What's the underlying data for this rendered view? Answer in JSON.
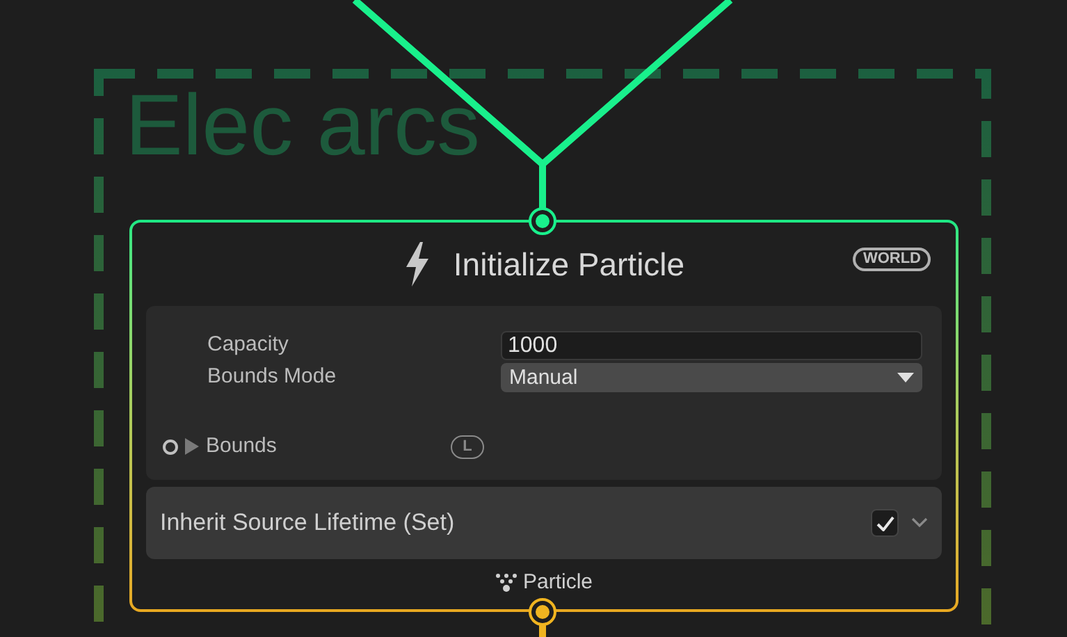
{
  "group": {
    "title": "Elec arcs"
  },
  "node": {
    "title": "Initialize Particle",
    "space_badge": "WORLD",
    "properties": [
      {
        "kind": "number",
        "label": "Capacity",
        "value": "1000"
      },
      {
        "kind": "dropdown",
        "label": "Bounds Mode",
        "value": "Manual"
      }
    ],
    "bounds": {
      "label": "Bounds",
      "expanded": false,
      "space_badge": "L"
    },
    "blocks": [
      {
        "title": "Inherit Source Lifetime (Set)",
        "checked": true,
        "expanded": false
      }
    ],
    "footer": "Particle"
  }
}
